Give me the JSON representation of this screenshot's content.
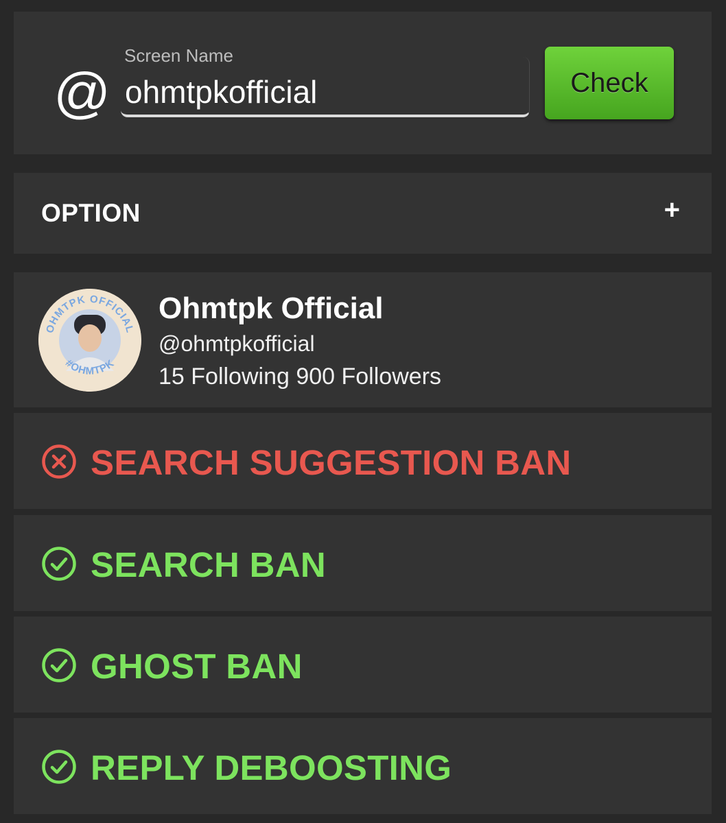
{
  "search": {
    "at_symbol": "@",
    "label": "Screen Name",
    "value": "ohmtpkofficial",
    "button_label": "Check"
  },
  "option": {
    "label": "OPTION",
    "toggle": "+"
  },
  "profile": {
    "name": "Ohmtpk Official",
    "handle": "@ohmtpkofficial",
    "stats": "15 Following 900 Followers",
    "avatar_ring_text": "OHMTPK OFFICIAL #OHMTPK"
  },
  "results": [
    {
      "label": "SEARCH SUGGESTION BAN",
      "status": "fail",
      "icon": "x-circle-icon",
      "color": "#e8584f"
    },
    {
      "label": "SEARCH BAN",
      "status": "pass",
      "icon": "check-circle-icon",
      "color": "#7de35e"
    },
    {
      "label": "GHOST BAN",
      "status": "pass",
      "icon": "check-circle-icon",
      "color": "#7de35e"
    },
    {
      "label": "REPLY DEBOOSTING",
      "status": "pass",
      "icon": "check-circle-icon",
      "color": "#7de35e"
    }
  ],
  "colors": {
    "background": "#282828",
    "card": "#333333",
    "fail": "#e8584f",
    "pass": "#7de35e",
    "button": "#5abb2c"
  }
}
